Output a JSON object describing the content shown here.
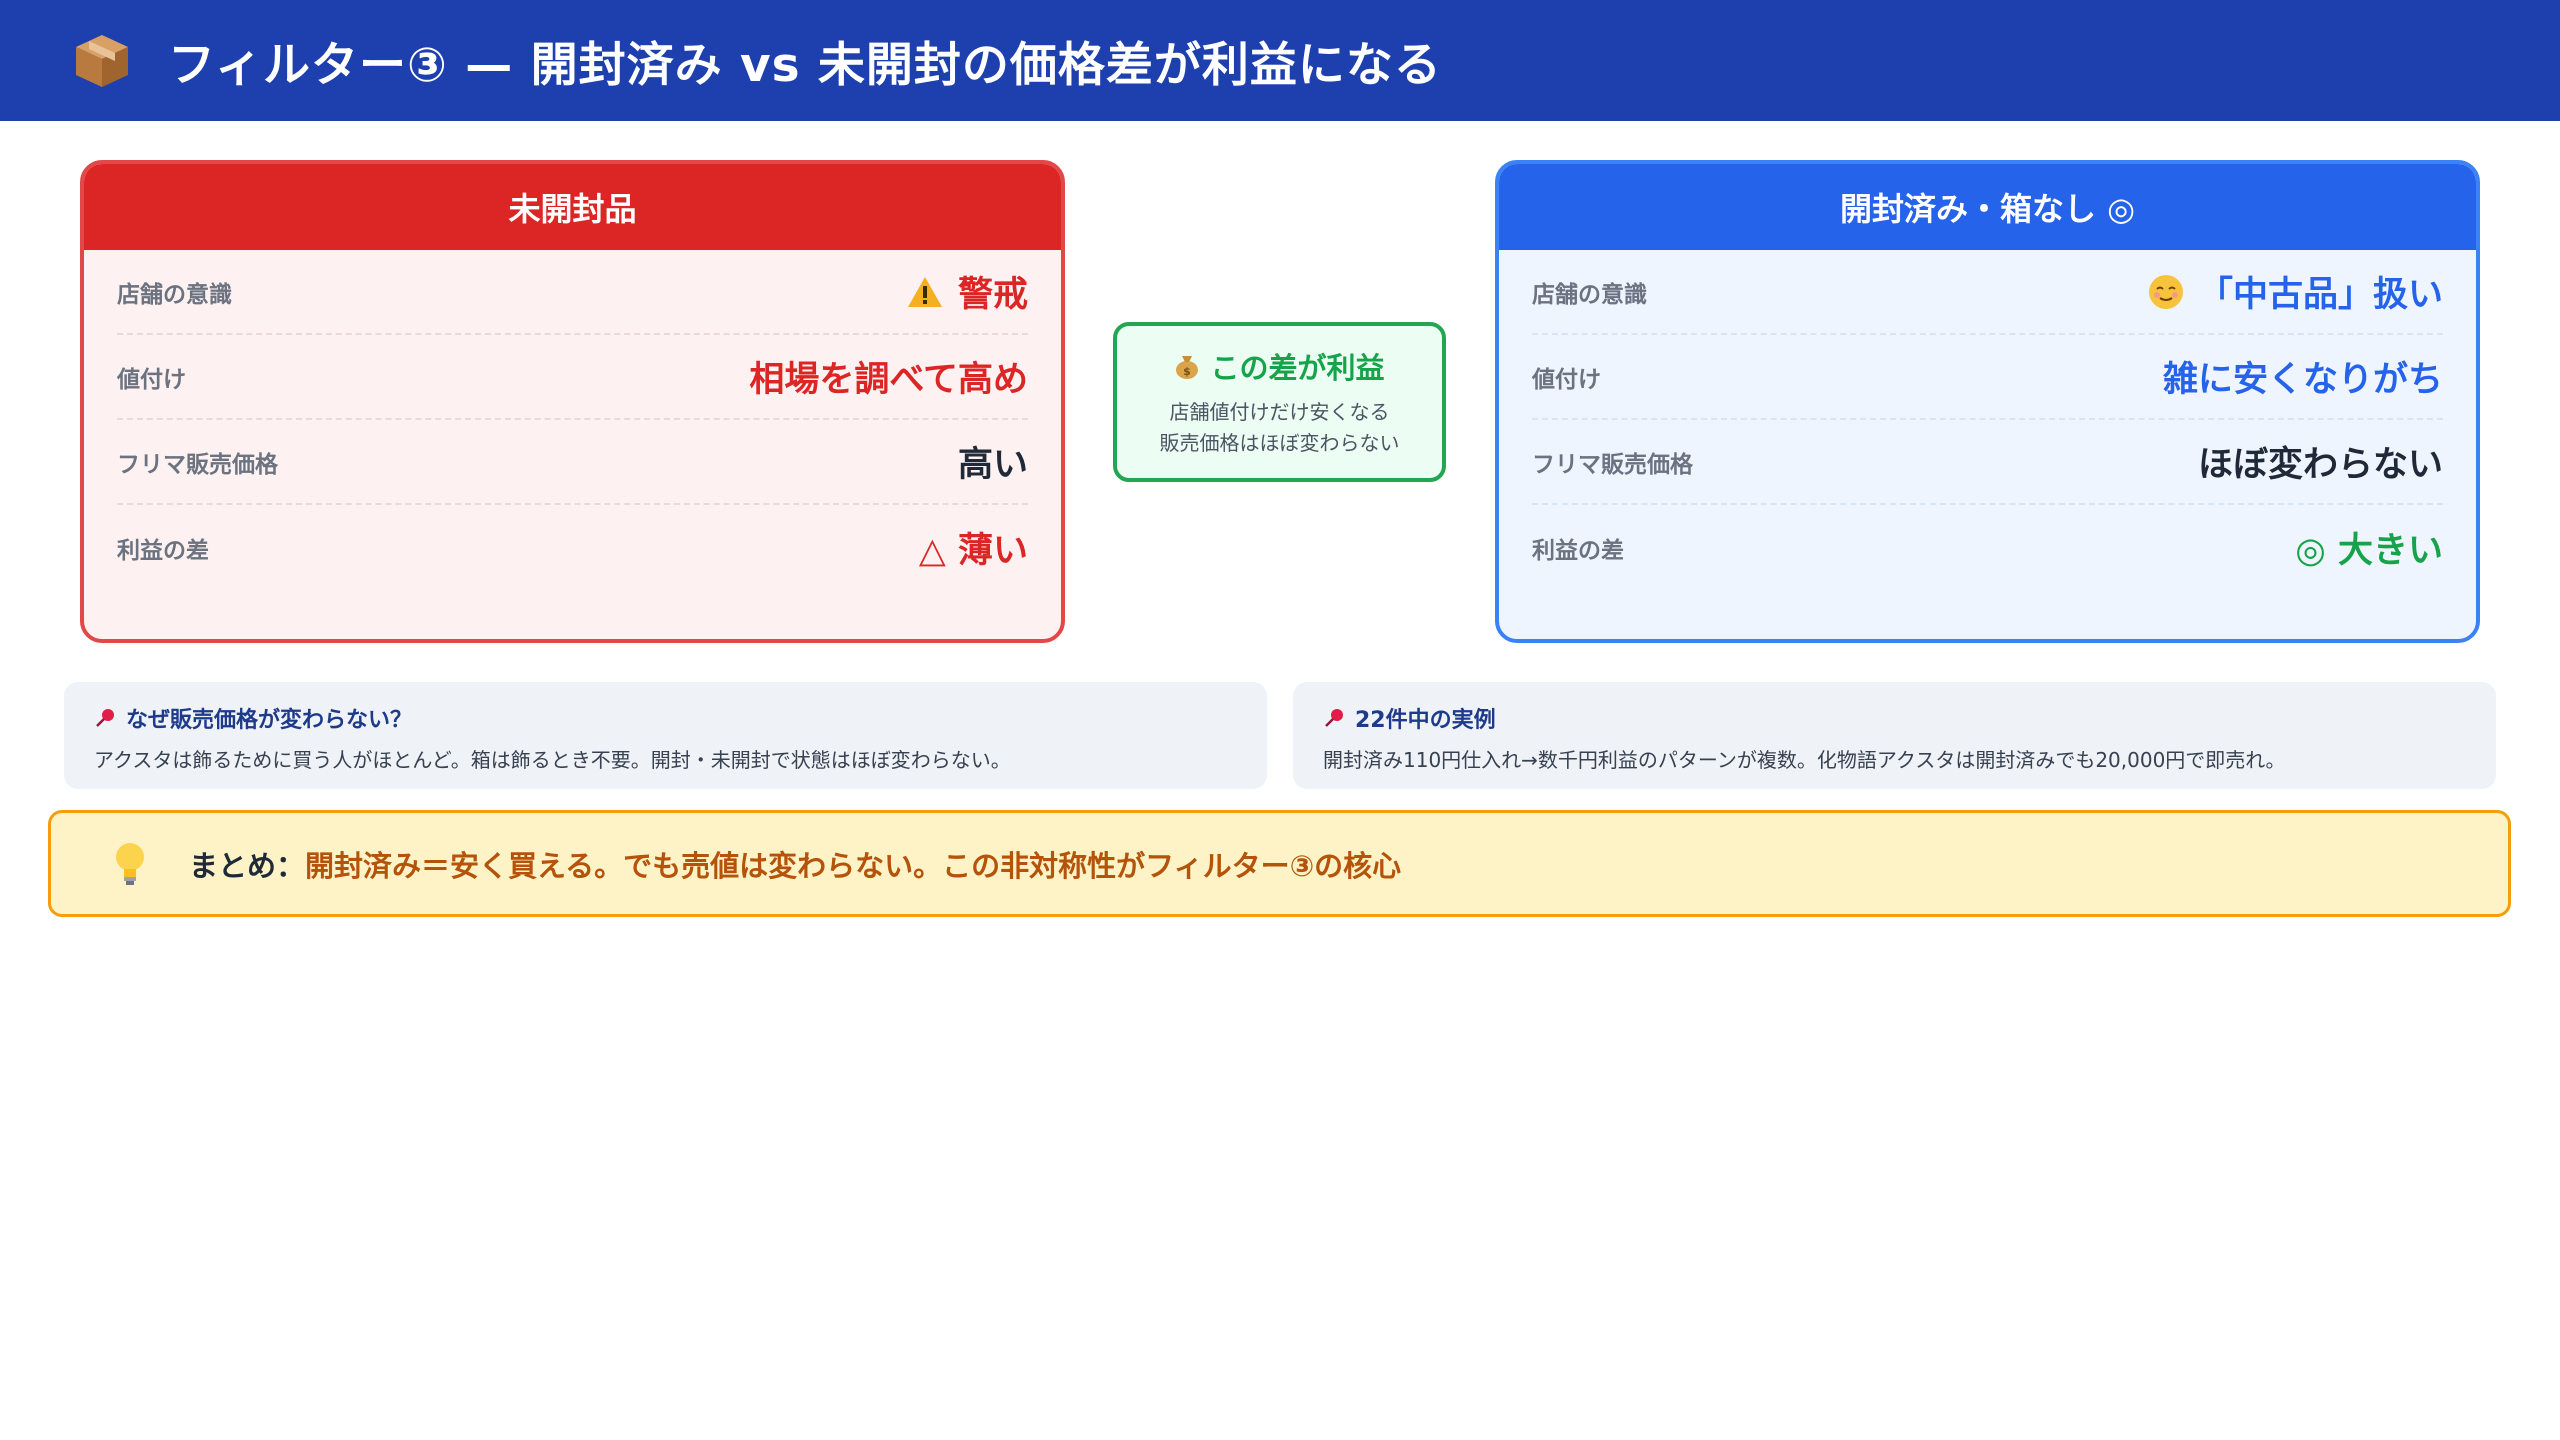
{
  "header": {
    "icon": "package-icon",
    "title": "フィルター③ — 開封済み vs 未開封の価格差が利益になる"
  },
  "left_card": {
    "title": "未開封品",
    "rows": [
      {
        "label": "店舗の意識",
        "value": "警戒",
        "icon": "warning-icon"
      },
      {
        "label": "値付け",
        "value": "相場を調べて高め"
      },
      {
        "label": "フリマ販売価格",
        "value": "高い"
      },
      {
        "label": "利益の差",
        "value": "△ 薄い"
      }
    ]
  },
  "right_card": {
    "title": "開封済み・箱なし ◎",
    "rows": [
      {
        "label": "店舗の意識",
        "value": "「中古品」扱い",
        "icon": "relieved-face-icon"
      },
      {
        "label": "値付け",
        "value": "雑に安くなりがち"
      },
      {
        "label": "フリマ販売価格",
        "value": "ほぼ変わらない"
      },
      {
        "label": "利益の差",
        "value": "◎ 大きい"
      }
    ]
  },
  "middle": {
    "icon": "money-bag-icon",
    "title": "この差が利益",
    "line1": "店舗値付けだけ安くなる",
    "line2": "販売価格はほぼ変わらない"
  },
  "info_left": {
    "icon": "pushpin-icon",
    "title": "なぜ販売価格が変わらない？",
    "text": "アクスタは飾るために買う人がほとんど。箱は飾るとき不要。開封・未開封で状態はほぼ変わらない。"
  },
  "info_right": {
    "icon": "pushpin-icon",
    "title": "22件中の実例",
    "text": "開封済み110円仕入れ→数千円利益のパターンが複数。化物語アクスタは開封済みでも20,000円で即売れ。"
  },
  "summary": {
    "icon": "lightbulb-icon",
    "label": "まとめ：",
    "text": "開封済み＝安く買える。でも売値は変わらない。この非対称性がフィルター③の核心"
  },
  "colors": {
    "header_bg": "#1e40af",
    "red_accent": "#dc2626",
    "blue_accent": "#2563eb",
    "green_accent": "#16a34a",
    "amber_accent": "#b45309"
  }
}
